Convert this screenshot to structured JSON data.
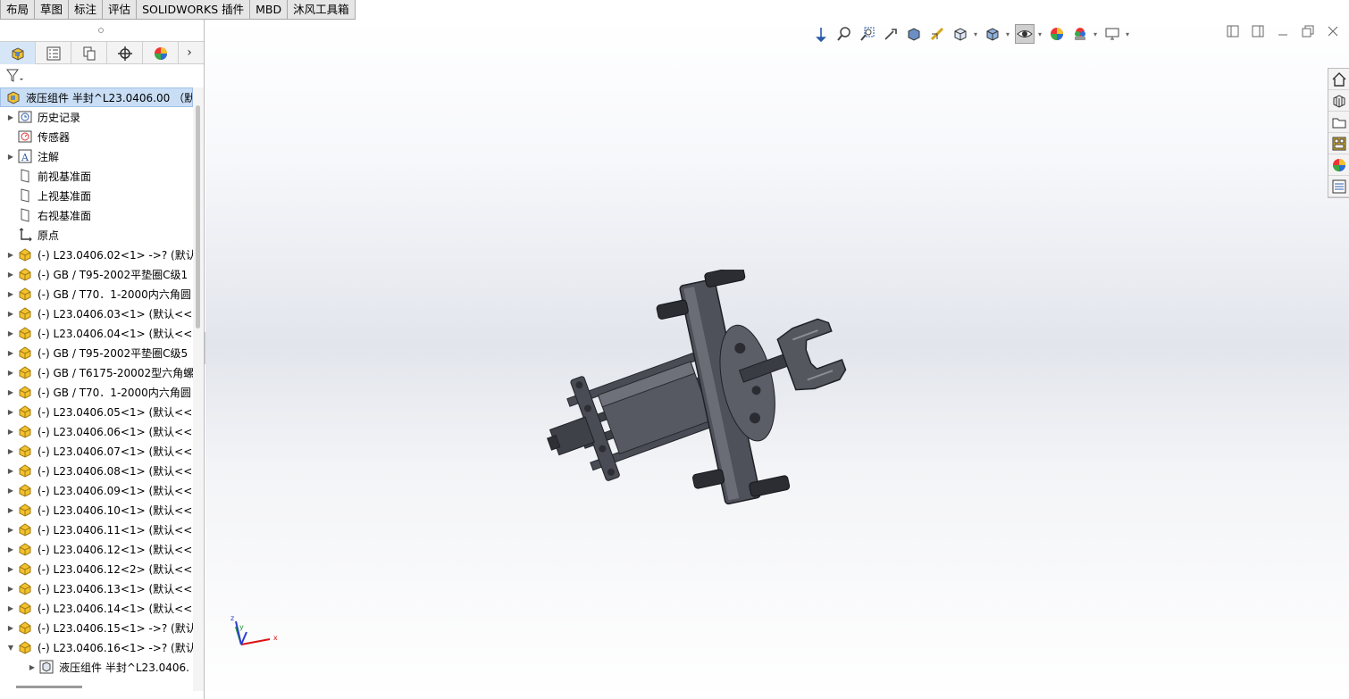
{
  "command_tabs": [
    "布局",
    "草图",
    "标注",
    "评估",
    "SOLIDWORKS 插件",
    "MBD",
    "沐风工具箱"
  ],
  "feature_tree": {
    "root": "液压组件 半封^L23.0406.00 （默认",
    "items": [
      {
        "label": "历史记录",
        "icon": "history-icon",
        "expandable": true
      },
      {
        "label": "传感器",
        "icon": "sensor-icon",
        "expandable": false
      },
      {
        "label": "注解",
        "icon": "annotation-icon",
        "expandable": true
      },
      {
        "label": "前视基准面",
        "icon": "plane-icon",
        "expandable": false
      },
      {
        "label": "上视基准面",
        "icon": "plane-icon",
        "expandable": false
      },
      {
        "label": "右视基准面",
        "icon": "plane-icon",
        "expandable": false
      },
      {
        "label": "原点",
        "icon": "origin-icon",
        "expandable": false
      },
      {
        "label": "(-) L23.0406.02<1> ->? (默认",
        "icon": "part-icon",
        "expandable": true
      },
      {
        "label": "(-) GB / T95-2002平垫圈C级1",
        "icon": "part-icon",
        "expandable": true
      },
      {
        "label": "(-) GB / T70．1-2000内六角圆",
        "icon": "part-icon",
        "expandable": true
      },
      {
        "label": "(-) L23.0406.03<1> (默认<<",
        "icon": "part-icon",
        "expandable": true
      },
      {
        "label": "(-) L23.0406.04<1> (默认<<",
        "icon": "part-icon",
        "expandable": true
      },
      {
        "label": "(-) GB / T95-2002平垫圈C级5",
        "icon": "part-icon",
        "expandable": true
      },
      {
        "label": "(-) GB / T6175-20002型六角螺",
        "icon": "part-icon",
        "expandable": true
      },
      {
        "label": "(-) GB / T70．1-2000内六角圆",
        "icon": "part-icon",
        "expandable": true
      },
      {
        "label": "(-) L23.0406.05<1> (默认<<",
        "icon": "part-icon",
        "expandable": true
      },
      {
        "label": "(-) L23.0406.06<1> (默认<<",
        "icon": "part-icon",
        "expandable": true
      },
      {
        "label": "(-) L23.0406.07<1> (默认<<",
        "icon": "part-icon",
        "expandable": true
      },
      {
        "label": "(-) L23.0406.08<1> (默认<<",
        "icon": "part-icon",
        "expandable": true
      },
      {
        "label": "(-) L23.0406.09<1> (默认<<",
        "icon": "part-icon",
        "expandable": true
      },
      {
        "label": "(-) L23.0406.10<1> (默认<<",
        "icon": "part-icon",
        "expandable": true
      },
      {
        "label": "(-) L23.0406.11<1> (默认<<",
        "icon": "part-icon",
        "expandable": true
      },
      {
        "label": "(-) L23.0406.12<1> (默认<<",
        "icon": "part-icon",
        "expandable": true
      },
      {
        "label": "(-) L23.0406.12<2> (默认<<",
        "icon": "part-icon",
        "expandable": true
      },
      {
        "label": "(-) L23.0406.13<1> (默认<<",
        "icon": "part-icon",
        "expandable": true
      },
      {
        "label": "(-) L23.0406.14<1> (默认<<",
        "icon": "part-icon",
        "expandable": true
      },
      {
        "label": "(-) L23.0406.15<1> ->? (默认",
        "icon": "part-icon",
        "expandable": true
      },
      {
        "label": "(-) L23.0406.16<1> ->? (默认",
        "icon": "part-icon",
        "expandable": true,
        "expanded": true
      }
    ],
    "child": "液压组件 半封^L23.0406."
  },
  "triad": {
    "x": "x",
    "y": "y",
    "z": "z"
  },
  "colors": {
    "accent": "#c9def5",
    "part_yellow": "#f2c12e",
    "model_dark": "#3b3d45"
  }
}
